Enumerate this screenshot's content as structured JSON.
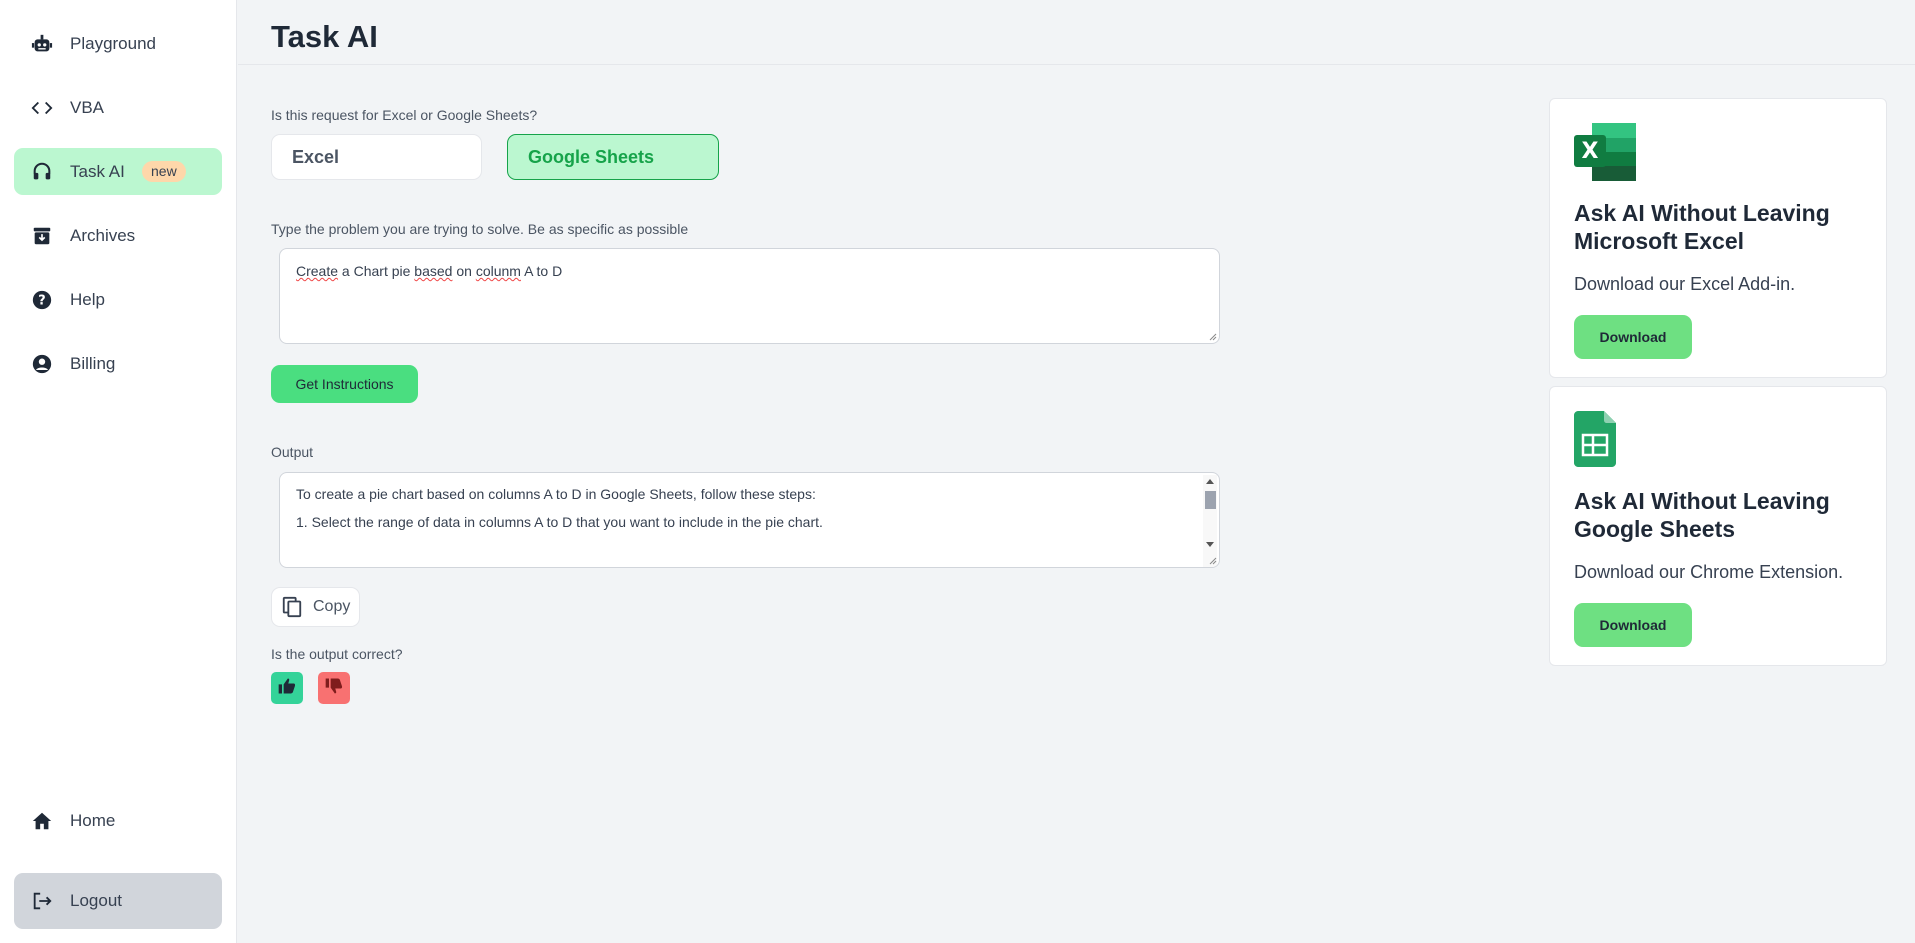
{
  "sidebar": {
    "items": [
      {
        "label": "Playground",
        "icon": "robot-icon"
      },
      {
        "label": "VBA",
        "icon": "code-icon"
      },
      {
        "label": "Task AI",
        "icon": "headset-icon",
        "badge": "new",
        "active": true
      },
      {
        "label": "Archives",
        "icon": "archive-icon"
      },
      {
        "label": "Help",
        "icon": "help-icon"
      },
      {
        "label": "Billing",
        "icon": "user-circle-icon"
      }
    ],
    "home_label": "Home",
    "logout_label": "Logout"
  },
  "header": {
    "title": "Task AI"
  },
  "main": {
    "platform_question": "Is this request for Excel or Google Sheets?",
    "platform_options": [
      "Excel",
      "Google Sheets"
    ],
    "selected_platform": "Google Sheets",
    "problem_label": "Type the problem you are trying to solve. Be as specific as possible",
    "problem_value": "Create a Chart pie based on colunm A to D",
    "get_instructions_label": "Get Instructions",
    "output_label": "Output",
    "output_lines": [
      "To create a pie chart based on columns A to D in Google Sheets, follow these steps:",
      "",
      "1. Select the range of data in columns A to D that you want to include in the pie chart."
    ],
    "copy_label": "Copy",
    "feedback_question": "Is the output correct?"
  },
  "cards": {
    "excel": {
      "title": "Ask AI Without Leaving Microsoft Excel",
      "desc": "Download our Excel Add-in.",
      "button": "Download"
    },
    "sheets": {
      "title": "Ask AI Without Leaving Google Sheets",
      "desc": "Download our Chrome Extension.",
      "button": "Download"
    }
  },
  "colors": {
    "accent": "#4ade80",
    "active_bg": "#bbf7d0",
    "selected_border": "#16a34a"
  }
}
